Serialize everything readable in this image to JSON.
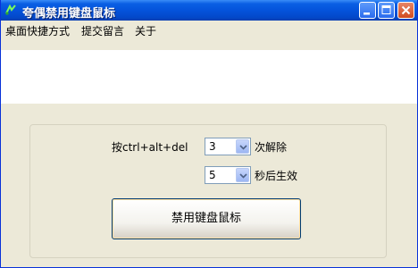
{
  "window": {
    "title": "夸偶禁用键盘鼠标"
  },
  "menu": {
    "items": [
      "桌面快捷方式",
      "提交留言",
      "关于"
    ]
  },
  "form": {
    "prefix_label": "按ctrl+alt+del",
    "count_value": "3",
    "count_suffix": "次解除",
    "delay_value": "5",
    "delay_suffix": "秒后生效",
    "action_button": "禁用键盘鼠标"
  },
  "icons": [
    "app-icon",
    "minimize-icon",
    "maximize-icon",
    "close-icon",
    "chevron-down-icon"
  ],
  "colors": {
    "titlebar": "#0453DB",
    "close_button": "#D14B1F",
    "window_bg": "#ECE9D8"
  }
}
